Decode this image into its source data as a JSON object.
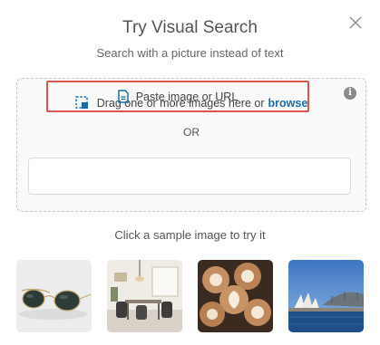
{
  "dialog": {
    "title": "Try Visual Search",
    "subtitle": "Search with a picture instead of text",
    "close_icon": "close-icon"
  },
  "dropzone": {
    "drag_text": "Drag one or more images here or",
    "browse_label": "browse",
    "or_label": "OR",
    "paste_label": "Paste image or URL",
    "info_icon": "info-icon",
    "upload_icon": "image-upload-icon",
    "paste_icon": "document-icon"
  },
  "samples": {
    "prompt": "Click a sample image to try it",
    "items": [
      {
        "name": "sunglasses"
      },
      {
        "name": "dining-room"
      },
      {
        "name": "latte-art-coffee"
      },
      {
        "name": "sydney-opera-house"
      }
    ]
  },
  "colors": {
    "accent": "#1a6fa8",
    "highlight": "#e05353"
  }
}
